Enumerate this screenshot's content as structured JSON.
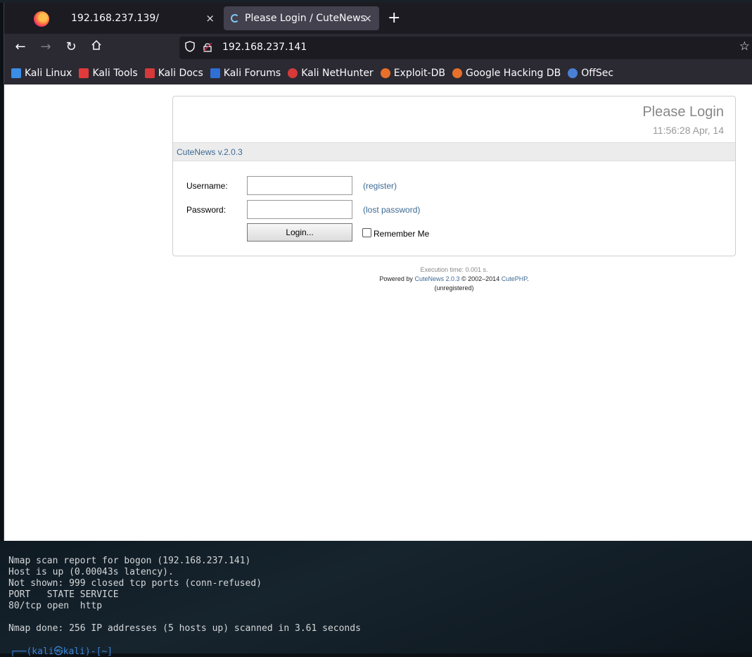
{
  "browser": {
    "tabs": [
      {
        "label": "192.168.237.139/",
        "active": false
      },
      {
        "label": "Please Login / CuteNews",
        "active": true
      }
    ],
    "new_tab_icon": "+",
    "close_icon": "×",
    "url": "192.168.237.141",
    "bookmarks": [
      {
        "label": "Kali Linux",
        "icon_color": "#3a8ee6"
      },
      {
        "label": "Kali Tools",
        "icon_color": "#e23a3a"
      },
      {
        "label": "Kali Docs",
        "icon_color": "#d63939"
      },
      {
        "label": "Kali Forums",
        "icon_color": "#2f6fd6"
      },
      {
        "label": "Kali NetHunter",
        "icon_color": "#d63939"
      },
      {
        "label": "Exploit-DB",
        "icon_color": "#e8702a"
      },
      {
        "label": "Google Hacking DB",
        "icon_color": "#e8702a"
      },
      {
        "label": "OffSec",
        "icon_color": "#4a7fd6"
      }
    ]
  },
  "login": {
    "title": "Please Login",
    "datetime": "11:56:28 Apr, 14",
    "version": "CuteNews v.2.0.3",
    "username_label": "Username:",
    "password_label": "Password:",
    "register_link": "(register)",
    "lost_password_link": "(lost password)",
    "login_button": "Login...",
    "remember_me": "Remember Me"
  },
  "footer": {
    "execution_time": "Execution time: 0.001 s.",
    "powered_by": "Powered by",
    "cutenews_link": "CuteNews 2.0.3",
    "copyright": "© 2002–2014",
    "cutephp_link": "CutePHP",
    "unregistered": "(unregistered)"
  },
  "terminal": {
    "output": "Nmap scan report for bogon (192.168.237.141)\nHost is up (0.00043s latency).\nNot shown: 999 closed tcp ports (conn-refused)\nPORT   STATE SERVICE\n80/tcp open  http\n\nNmap done: 256 IP addresses (5 hosts up) scanned in 3.61 seconds",
    "prompt": "┌──(kali㉿kali)-[~]"
  }
}
